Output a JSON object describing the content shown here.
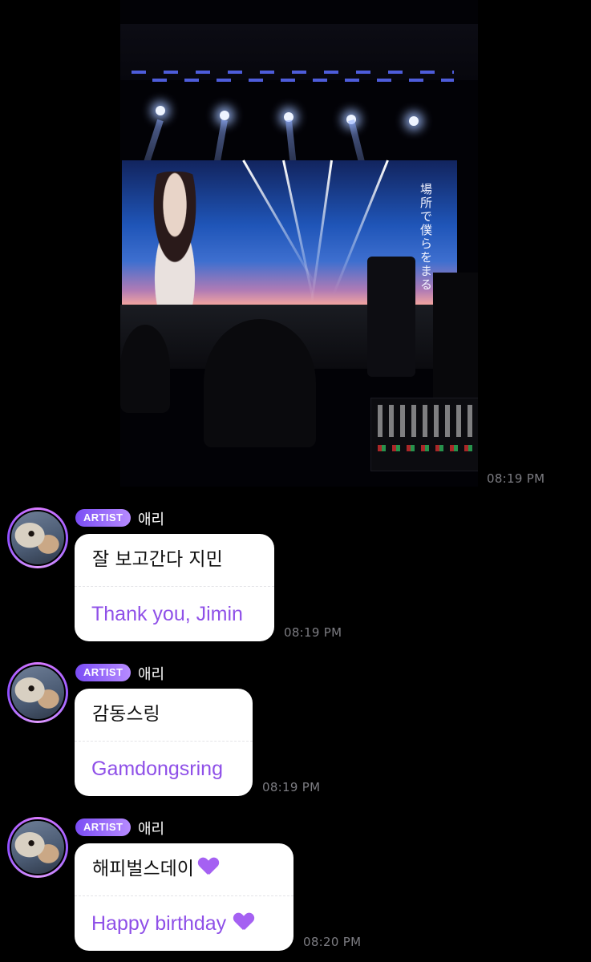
{
  "photo_message": {
    "timestamp": "08:19 PM",
    "screen_text": "場所で僕らをまる"
  },
  "messages": [
    {
      "badge": "ARTIST",
      "author": "애리",
      "text_ko": "잘 보고간다 지민",
      "text_en": "Thank you, Jimin",
      "timestamp": "08:19 PM"
    },
    {
      "badge": "ARTIST",
      "author": "애리",
      "text_ko": "감동스링",
      "text_en": "Gamdongsring",
      "timestamp": "08:19 PM"
    },
    {
      "badge": "ARTIST",
      "author": "애리",
      "text_ko": "해피벌스데이",
      "text_en": "Happy birthday",
      "emoji": "purple-heart",
      "timestamp": "08:20 PM"
    }
  ],
  "colors": {
    "background": "#000000",
    "badge_start": "#7a4df5",
    "badge_end": "#b78bff",
    "translation_text": "#8f50e8",
    "timestamp": "#7c7c82"
  }
}
